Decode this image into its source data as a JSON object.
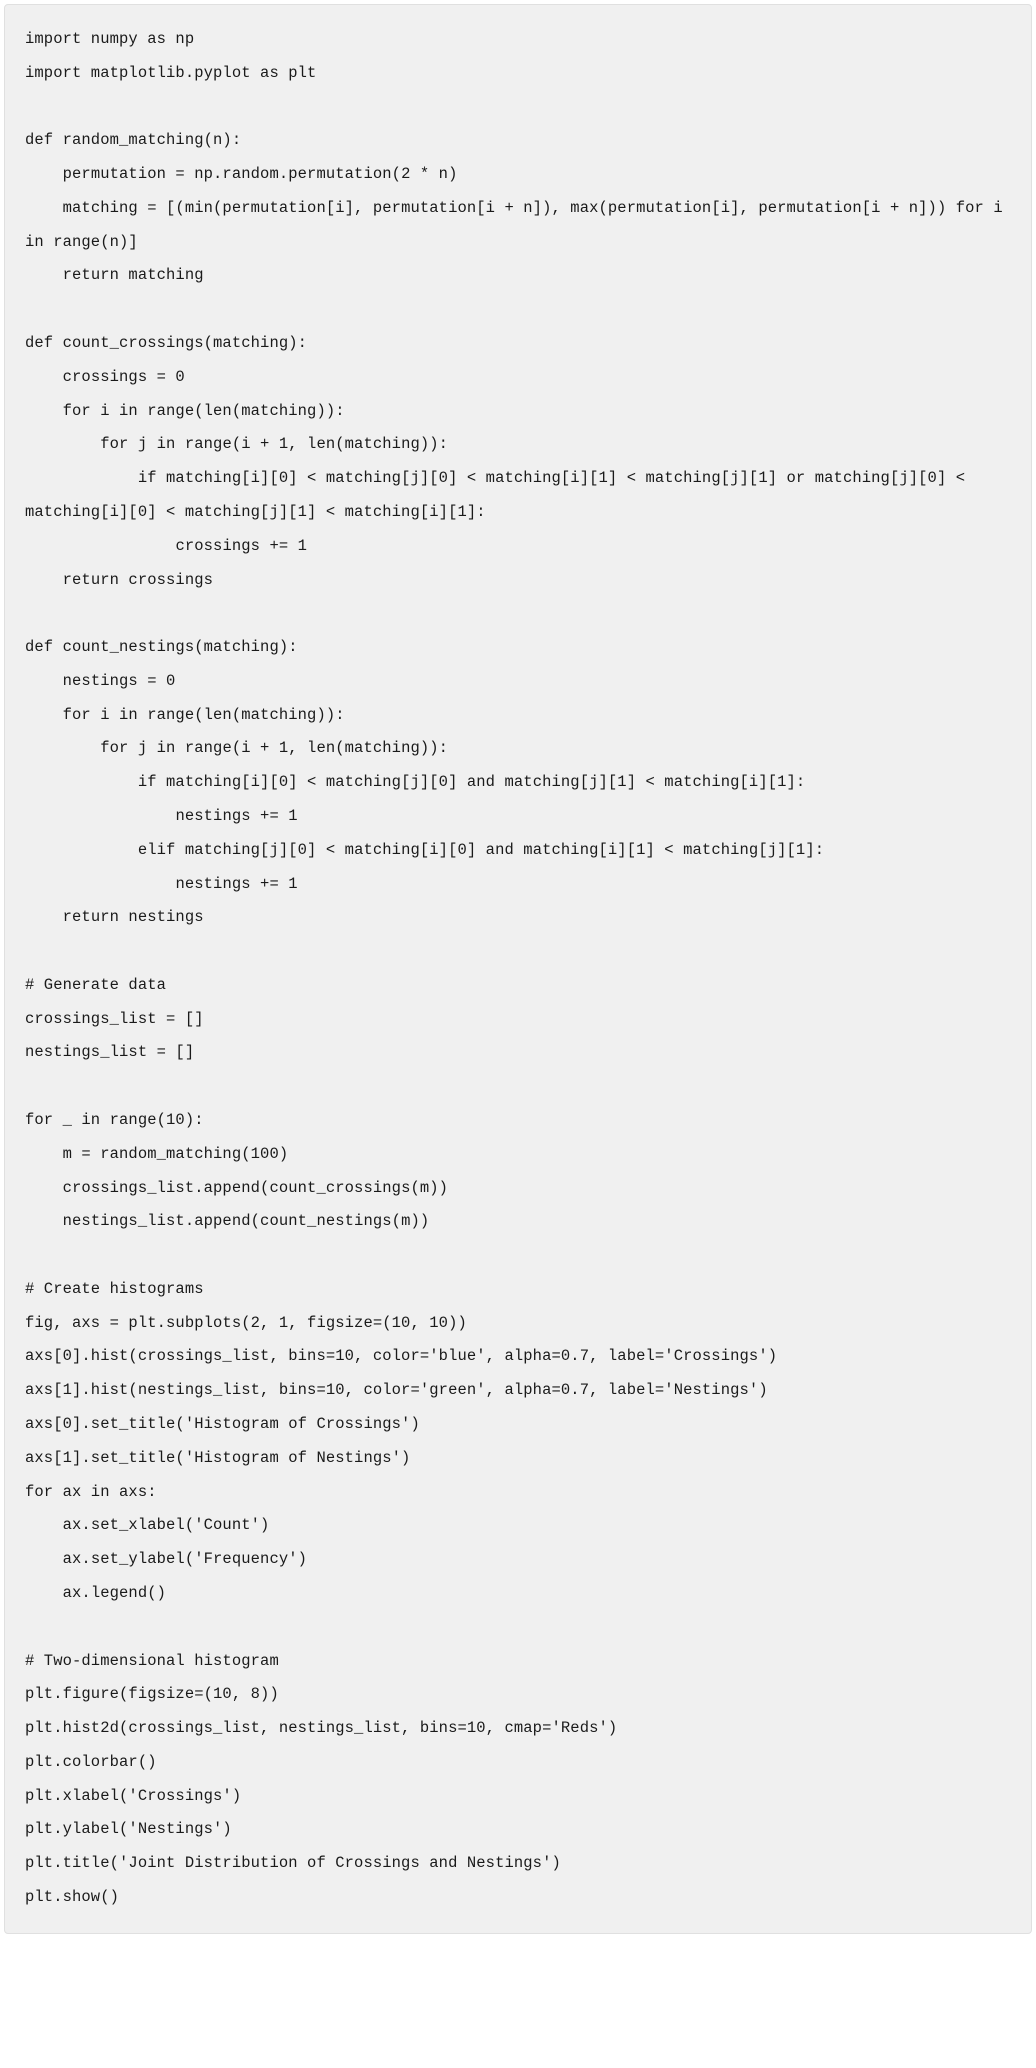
{
  "code": "import numpy as np\nimport matplotlib.pyplot as plt\n\ndef random_matching(n):\n    permutation = np.random.permutation(2 * n)\n    matching = [(min(permutation[i], permutation[i + n]), max(permutation[i], permutation[i + n])) for i in range(n)]\n    return matching\n\ndef count_crossings(matching):\n    crossings = 0\n    for i in range(len(matching)):\n        for j in range(i + 1, len(matching)):\n            if matching[i][0] < matching[j][0] < matching[i][1] < matching[j][1] or matching[j][0] < matching[i][0] < matching[j][1] < matching[i][1]:\n                crossings += 1\n    return crossings\n\ndef count_nestings(matching):\n    nestings = 0\n    for i in range(len(matching)):\n        for j in range(i + 1, len(matching)):\n            if matching[i][0] < matching[j][0] and matching[j][1] < matching[i][1]:\n                nestings += 1\n            elif matching[j][0] < matching[i][0] and matching[i][1] < matching[j][1]:\n                nestings += 1\n    return nestings\n\n# Generate data\ncrossings_list = []\nnestings_list = []\n\nfor _ in range(10):\n    m = random_matching(100)\n    crossings_list.append(count_crossings(m))\n    nestings_list.append(count_nestings(m))\n\n# Create histograms\nfig, axs = plt.subplots(2, 1, figsize=(10, 10))\naxs[0].hist(crossings_list, bins=10, color='blue', alpha=0.7, label='Crossings')\naxs[1].hist(nestings_list, bins=10, color='green', alpha=0.7, label='Nestings')\naxs[0].set_title('Histogram of Crossings')\naxs[1].set_title('Histogram of Nestings')\nfor ax in axs:\n    ax.set_xlabel('Count')\n    ax.set_ylabel('Frequency')\n    ax.legend()\n\n# Two-dimensional histogram\nplt.figure(figsize=(10, 8))\nplt.hist2d(crossings_list, nestings_list, bins=10, cmap='Reds')\nplt.colorbar()\nplt.xlabel('Crossings')\nplt.ylabel('Nestings')\nplt.title('Joint Distribution of Crossings and Nestings')\nplt.show()"
}
